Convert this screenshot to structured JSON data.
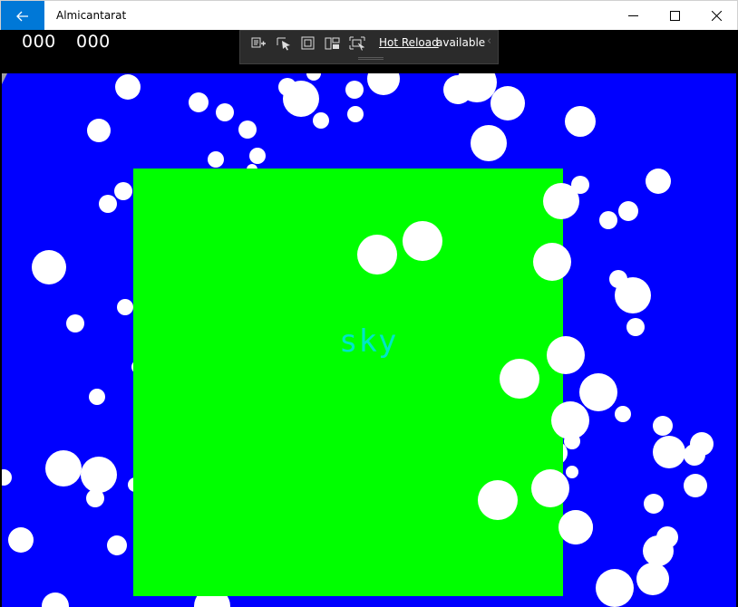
{
  "window": {
    "title": "Almicantarat"
  },
  "hud": {
    "score_left": "000",
    "score_right": "000"
  },
  "toolbar": {
    "hot_reload_link": "Hot Reload",
    "hot_reload_status": "available",
    "icons": [
      "live-visual-tree-icon",
      "select-element-icon",
      "display-layout-adorners-icon",
      "track-focus-icon",
      "xaml-binding-icon"
    ]
  },
  "scene": {
    "label": "sky",
    "colors": {
      "background": "#0000ff",
      "box": "#00ff00",
      "label": "#00e5c8",
      "snow": "#ffffff",
      "accent": "#0078d7"
    }
  }
}
